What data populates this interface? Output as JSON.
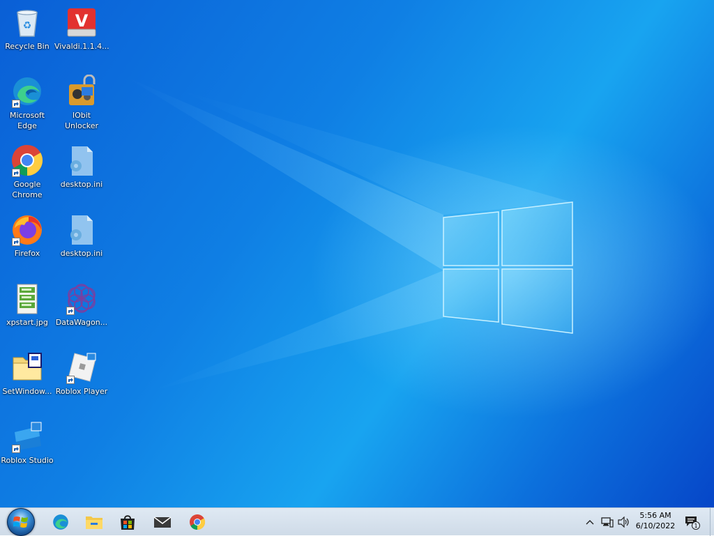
{
  "desktop": {
    "icons": [
      {
        "label": "Recycle Bin",
        "icon": "recycle-bin-icon",
        "shortcut": false
      },
      {
        "label": "Vivaldi.1.1.4...",
        "icon": "vivaldi-installer-icon",
        "shortcut": false
      },
      {
        "label": "Microsoft\nEdge",
        "icon": "edge-icon",
        "shortcut": true
      },
      {
        "label": "IObit\nUnlocker",
        "icon": "iobit-unlocker-icon",
        "shortcut": false
      },
      {
        "label": "Google\nChrome",
        "icon": "chrome-icon",
        "shortcut": true
      },
      {
        "label": "desktop.ini",
        "icon": "settings-file-icon",
        "shortcut": false
      },
      {
        "label": "Firefox",
        "icon": "firefox-icon",
        "shortcut": true
      },
      {
        "label": "desktop.ini",
        "icon": "settings-file-icon",
        "shortcut": false
      },
      {
        "label": "xpstart.jpg",
        "icon": "image-file-icon",
        "shortcut": false
      },
      {
        "label": "DataWagon...",
        "icon": "datawagon-icon",
        "shortcut": true
      },
      {
        "label": "SetWindow...",
        "icon": "setwindow-file-icon",
        "shortcut": false
      },
      {
        "label": "Roblox Player",
        "icon": "roblox-player-icon",
        "shortcut": true
      },
      {
        "label": "Roblox Studio",
        "icon": "roblox-studio-icon",
        "shortcut": true
      }
    ]
  },
  "taskbar": {
    "pinned": [
      "start-orb-icon",
      "edge-icon",
      "file-explorer-icon",
      "microsoft-store-icon",
      "mail-icon",
      "chrome-icon"
    ],
    "tray": {
      "time": "5:56 AM",
      "date": "6/10/2022",
      "notification_count": "1"
    }
  },
  "colors": {
    "desktop_blue": "#0f7fe4",
    "taskbar_bg": "#dfe9f3"
  }
}
